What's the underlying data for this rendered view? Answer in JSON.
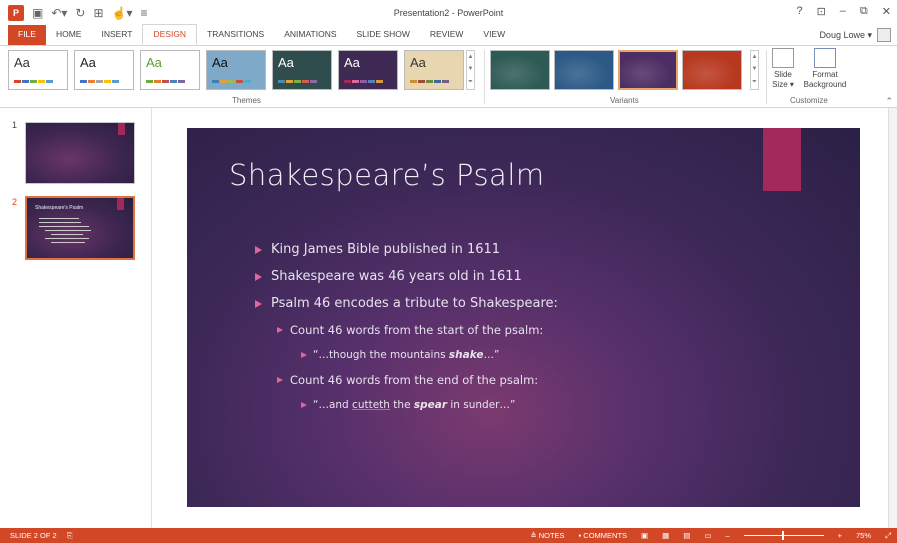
{
  "window": {
    "title": "Presentation2 - PowerPoint",
    "controls": [
      "?",
      "⊡",
      "–",
      "⧉",
      "✕"
    ]
  },
  "qat": {
    "logo": "P",
    "icons": [
      "save-icon",
      "undo-icon",
      "redo-icon",
      "preview-icon",
      "touch-icon",
      "customize-icon"
    ]
  },
  "tabs": [
    "FILE",
    "HOME",
    "INSERT",
    "DESIGN",
    "TRANSITIONS",
    "ANIMATIONS",
    "SLIDE SHOW",
    "REVIEW",
    "VIEW"
  ],
  "active_tab": "DESIGN",
  "user": {
    "name": "Doug Lowe ▾"
  },
  "ribbon": {
    "themes_label": "Themes",
    "variants_label": "Variants",
    "customize_label": "Customize",
    "themes": [
      {
        "aa": "Aa",
        "bg": "#ffffff",
        "fg": "#333333",
        "colors": [
          "#d24726",
          "#4472c4",
          "#70ad47",
          "#ffc000",
          "#5b9bd5"
        ]
      },
      {
        "aa": "Aa",
        "bg": "#ffffff",
        "fg": "#222222",
        "colors": [
          "#4472c4",
          "#ed7d31",
          "#a5a5a5",
          "#ffc000",
          "#5b9bd5"
        ]
      },
      {
        "aa": "Aa",
        "bg": "#ffffff",
        "fg": "#5a9e2f",
        "colors": [
          "#6aab3b",
          "#e57e2b",
          "#c0504d",
          "#4f81bd",
          "#8064a2"
        ]
      },
      {
        "aa": "Aa",
        "bg": "#7fa9c8",
        "fg": "#111111",
        "colors": [
          "#3f7fb8",
          "#e2a03c",
          "#9bbb59",
          "#c0504d",
          "#4bacc6"
        ]
      },
      {
        "aa": "Aa",
        "bg": "#2f4d4c",
        "fg": "#ffffff",
        "colors": [
          "#4e8aad",
          "#e0a43a",
          "#7eb04f",
          "#d35f52",
          "#8a6aa6"
        ]
      },
      {
        "aa": "Aa",
        "bg": "#3e2a55",
        "fg": "#ffffff",
        "colors": [
          "#a3295b",
          "#e0669b",
          "#8d5ea8",
          "#5c7fbd",
          "#d89a3e"
        ]
      },
      {
        "aa": "Aa",
        "bg": "#e8d6b0",
        "fg": "#333333",
        "colors": [
          "#c8902c",
          "#a44b3a",
          "#6e8a3c",
          "#3a6a8e",
          "#7a5a8c"
        ]
      }
    ],
    "variants": [
      {
        "bg": "#2e5a55"
      },
      {
        "bg": "#2c5a86"
      },
      {
        "bg": "#4c2d63"
      },
      {
        "bg": "#b8381f"
      }
    ],
    "slide_size": {
      "line1": "Slide",
      "line2": "Size ▾"
    },
    "format_background": {
      "line1": "Format",
      "line2": "Background"
    }
  },
  "slides_pane": [
    {
      "number": "1",
      "title": ""
    },
    {
      "number": "2",
      "title": "Shakespeare's Psalm"
    }
  ],
  "slide": {
    "title": "Shakespeare’s Psalm",
    "bullets": [
      {
        "level": 1,
        "text": "King James Bible published in 1611"
      },
      {
        "level": 1,
        "text": "Shakespeare was 46 years old in 1611"
      },
      {
        "level": 1,
        "text": "Psalm 46 encodes a tribute to Shakespeare:"
      },
      {
        "level": 2,
        "text": "Count 46 words from the start of the psalm:"
      },
      {
        "level": 3,
        "pre": "“…though the mountains ",
        "em": "shake",
        "post": "…”"
      },
      {
        "level": 2,
        "text": "Count 46 words from the end of the psalm:"
      },
      {
        "level": 3,
        "pre": "“…and ",
        "ul": "cutteth",
        "mid": " the ",
        "em": "spear",
        "post": " in sunder…”"
      }
    ]
  },
  "status": {
    "slide_info": "SLIDE 2 OF 2",
    "notes": "≜ NOTES",
    "comments": "▪ COMMENTS",
    "zoom_minus": "–",
    "zoom_plus": "+",
    "zoom": "75%"
  },
  "colors": {
    "accent": "#d24726",
    "slide_bookmark": "#a3295b",
    "bullet": "#e0669b"
  }
}
